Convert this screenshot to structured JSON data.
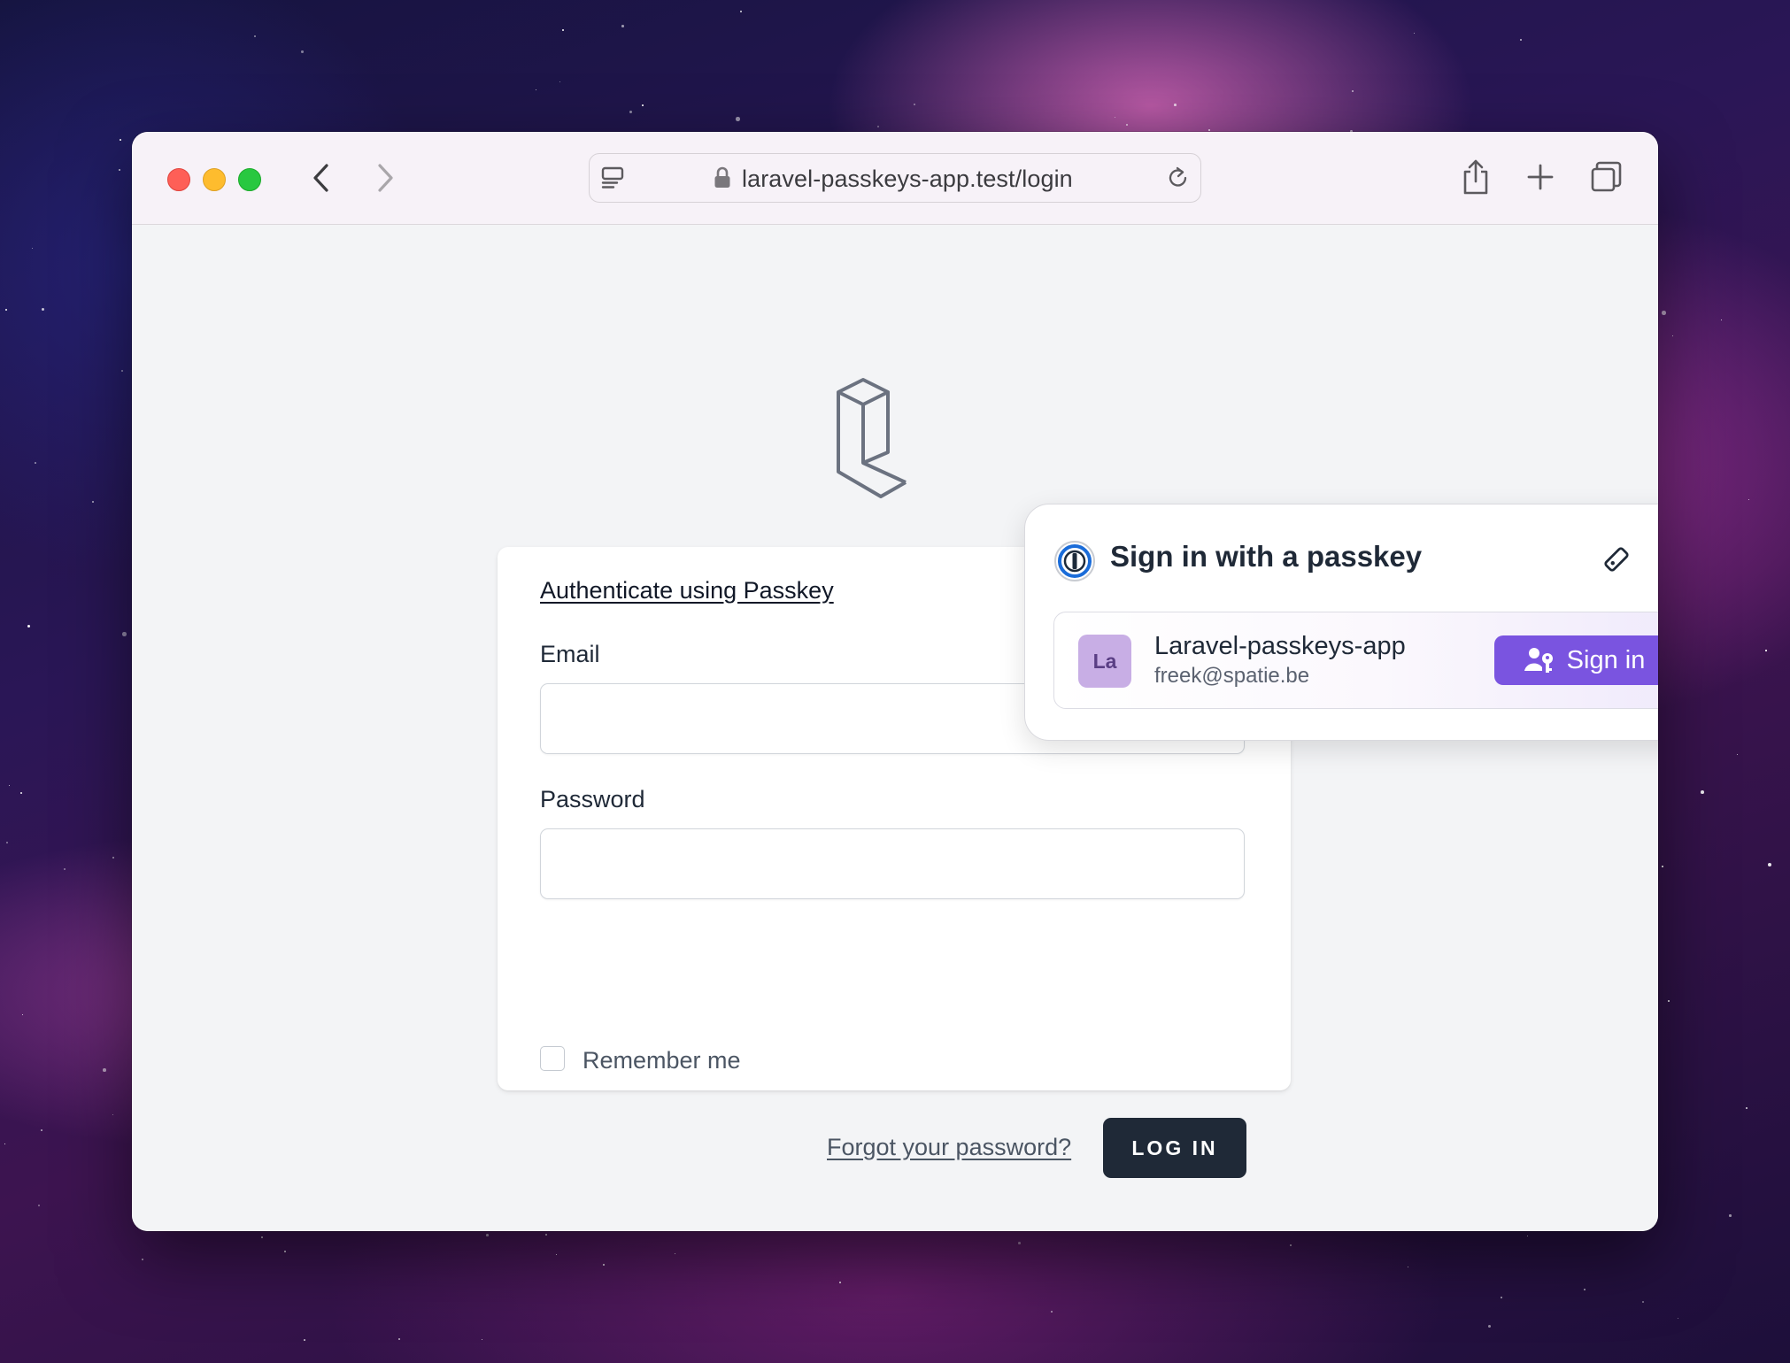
{
  "browser": {
    "url": "laravel-passkeys-app.test/login"
  },
  "login": {
    "passkey_link": "Authenticate using Passkey",
    "email_label": "Email",
    "email_value": "",
    "password_label": "Password",
    "password_value": "",
    "remember_label": "Remember me",
    "remember_checked": false,
    "forgot_link": "Forgot your password?",
    "login_button": "LOG IN"
  },
  "passkey_popup": {
    "title": "Sign in with a passkey",
    "account": {
      "avatar_initials": "La",
      "name": "Laravel-passkeys-app",
      "email": "freek@spatie.be"
    },
    "sign_in_button": "Sign in"
  },
  "colors": {
    "accent_purple": "#7a54e0",
    "login_button_bg": "#1f2937",
    "avatar_bg": "#c8aee5"
  },
  "icons": [
    "sidebar-icon",
    "lock-icon",
    "reload-icon",
    "back-icon",
    "forward-icon",
    "share-icon",
    "new-tab-icon",
    "tabs-overview-icon",
    "laravel-logo",
    "password-manager-icon",
    "tag-icon",
    "close-icon",
    "user-key-icon"
  ]
}
